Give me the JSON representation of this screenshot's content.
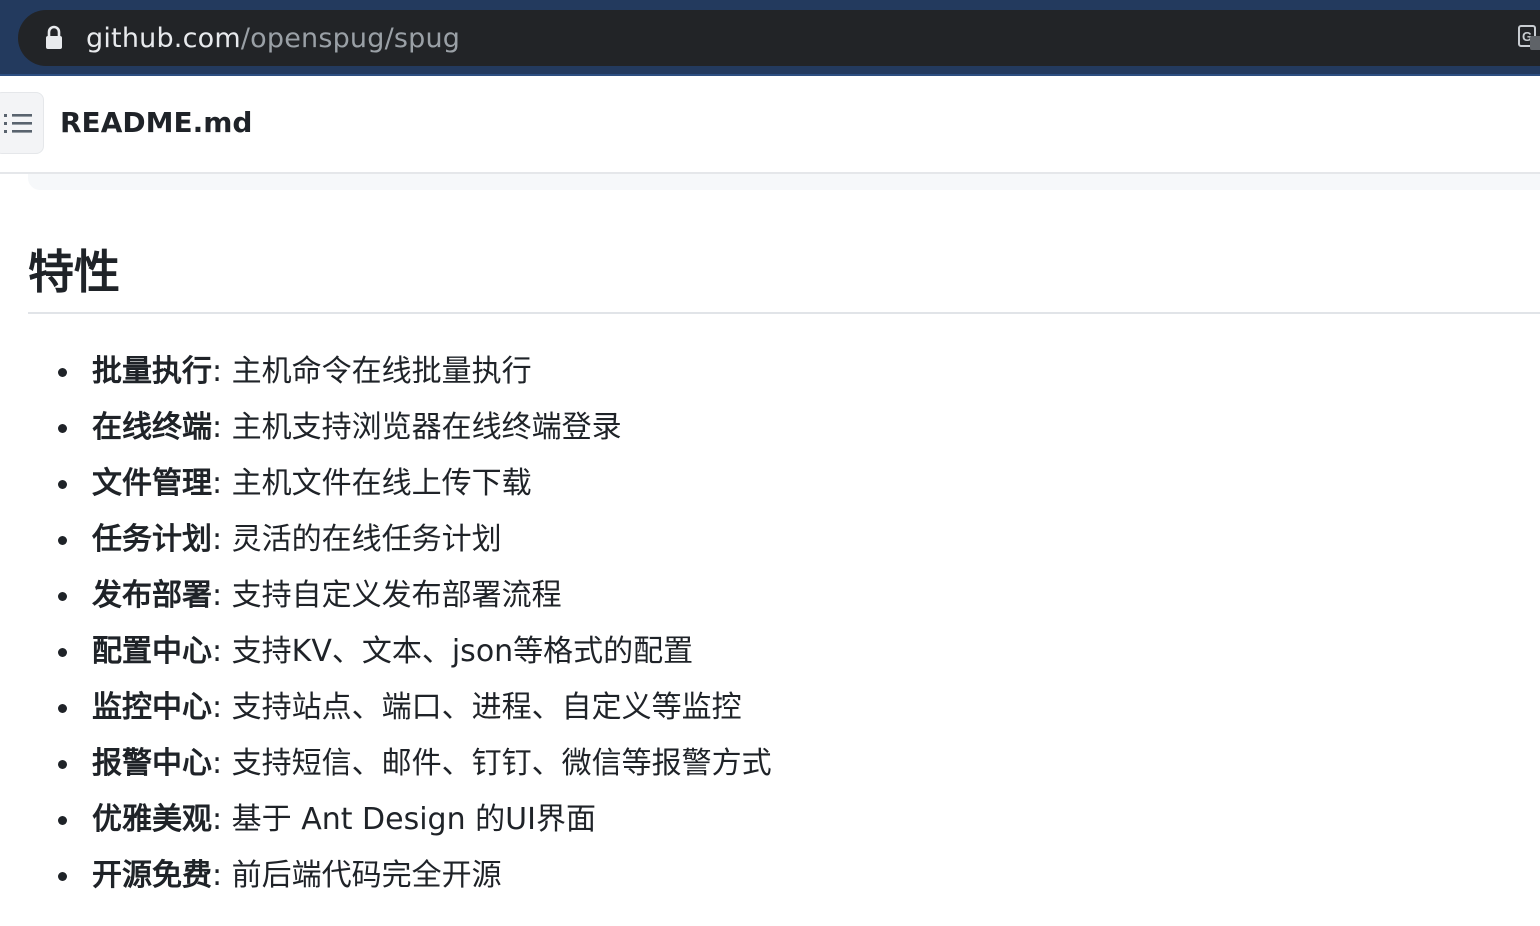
{
  "browser": {
    "url_host": "github.com",
    "url_path": "/openspug/spug"
  },
  "readme": {
    "filename": "README.md"
  },
  "section": {
    "heading": "特性"
  },
  "features": [
    {
      "name": "批量执行",
      "sep": ": ",
      "desc": "主机命令在线批量执行"
    },
    {
      "name": "在线终端",
      "sep": ": ",
      "desc": "主机支持浏览器在线终端登录"
    },
    {
      "name": "文件管理",
      "sep": ": ",
      "desc": "主机文件在线上传下载"
    },
    {
      "name": "任务计划",
      "sep": ": ",
      "desc": "灵活的在线任务计划"
    },
    {
      "name": "发布部署",
      "sep": ": ",
      "desc": "支持自定义发布部署流程"
    },
    {
      "name": "配置中心",
      "sep": ": ",
      "desc": "支持KV、文本、json等格式的配置"
    },
    {
      "name": "监控中心",
      "sep": ": ",
      "desc": "支持站点、端口、进程、自定义等监控"
    },
    {
      "name": "报警中心",
      "sep": ": ",
      "desc": "支持短信、邮件、钉钉、微信等报警方式"
    },
    {
      "name": "优雅美观",
      "sep": ": ",
      "desc": "基于 Ant Design 的UI界面"
    },
    {
      "name": "开源免费",
      "sep": ": ",
      "desc": "前后端代码完全开源"
    }
  ],
  "colors": {
    "browser_frame": "#233a5e",
    "url_field": "#222427",
    "text": "#1f2328"
  }
}
